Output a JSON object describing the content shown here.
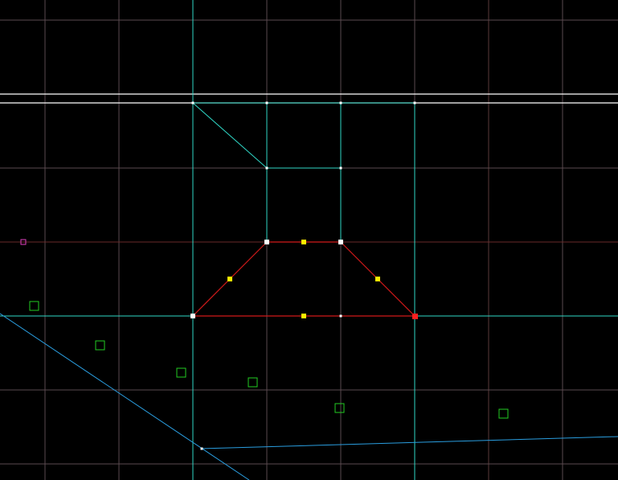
{
  "editor": {
    "colors": {
      "background": "#000000",
      "grid": "#5a4a50",
      "grid_axis": "#6a2a2a",
      "grid_axis_v": "#5a3a3a",
      "line_default": "#2fd7c6",
      "line_selected": "#d11a1a",
      "line_boundary": "#ffffff",
      "line_blue": "#2a9ee0",
      "vertex_default": "#ffffff",
      "vertex_selected": "#ff2020",
      "midpoint": "#ffee00",
      "thing": "#22cc22",
      "player_start": "#e040c0"
    }
  }
}
